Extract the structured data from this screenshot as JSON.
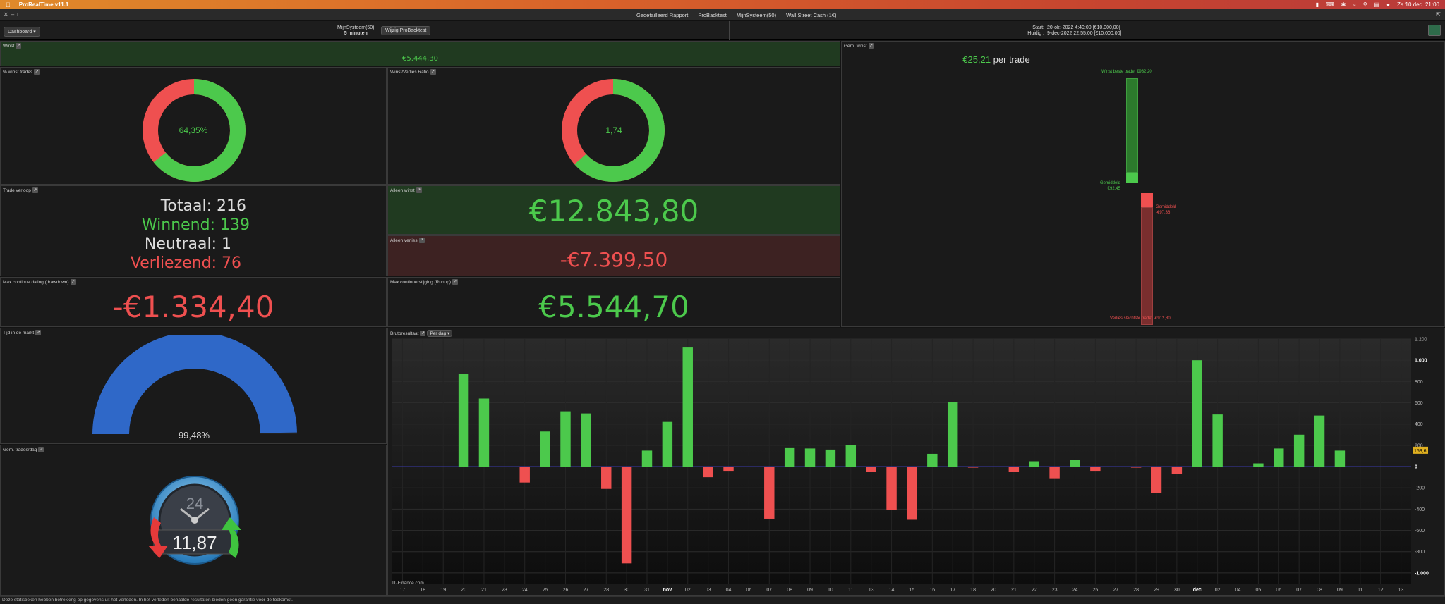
{
  "menubar": {
    "app_name": "ProRealTime v11.1",
    "clock": "Za 10 dec.  21:00"
  },
  "titlebar": {
    "tabs": [
      "Gedetailleerd Rapport",
      "ProBacktest",
      "MijnSysteem(50)",
      "Wall Street Cash (1€)"
    ]
  },
  "topbar": {
    "dashboard_label": "Dashboard",
    "system_name": "MijnSysteem(50)",
    "timeframe": "5 minuten",
    "wijzig_label": "Wijzig ProBacktest",
    "start_label": "Start:",
    "start_value": "20-okt-2022 4:40:00 [€10.000,00]",
    "huidig_label": "Huidig :",
    "huidig_value": "9-dec-2022 22:55:00 [€10.000,00]"
  },
  "winst": {
    "title": "Winst",
    "value": "€5.444,30"
  },
  "pct_winst": {
    "title": "% winst trades",
    "value": "64,35%",
    "fraction": 0.6435
  },
  "wv_ratio": {
    "title": "Winst/Verlies Ratio",
    "value": "1,74",
    "fraction": 0.635
  },
  "gem_winst": {
    "title": "Gem. winst",
    "per_trade_value": "€25,21",
    "per_trade_label": "per trade",
    "best_label": "Winst beste trade: €932,20",
    "avg_win_label": "Gemiddeld",
    "avg_win_value": "€92,45",
    "avg_loss_label": "Gemiddeld",
    "avg_loss_value": "-€97,36",
    "worst_label": "Verlies slechtste trade: -€912,80",
    "best": 932.2,
    "avg_win": 92.45,
    "avg_loss": -97.36,
    "worst": -912.8
  },
  "trade_verloop": {
    "title": "Trade verloop",
    "rows": [
      {
        "label": "Totaal:",
        "value": "216"
      },
      {
        "label": "Winnend:",
        "value": "139"
      },
      {
        "label": "Neutraal:",
        "value": "1"
      },
      {
        "label": "Verliezend:",
        "value": "76"
      }
    ]
  },
  "alleen_winst": {
    "title": "Alleen winst",
    "value": "€12.843,80"
  },
  "alleen_verlies": {
    "title": "Alleen verlies",
    "value": "-€7.399,50"
  },
  "max_drawdown": {
    "title": "Max continue daling (drawdown)",
    "value": "-€1.334,40"
  },
  "max_runup": {
    "title": "Max continue stijging (Runup)",
    "value": "€5.544,70"
  },
  "tijd_markt": {
    "title": "Tijd in de markt",
    "value": "99,48%",
    "fraction": 0.9948
  },
  "gem_trades": {
    "title": "Gem. trades/dag",
    "value": "11,87",
    "dial_label": "24"
  },
  "colors": {
    "green": "#4cc94c",
    "red": "#ef5050",
    "blue": "#2f68c8"
  },
  "chart_data": {
    "type": "bar",
    "title": "Brutoresultaat",
    "period_selector": "Per dag",
    "watermark": "IT-Finance.com",
    "current_value_tag": "153,6",
    "ylim": [
      -1100,
      1200
    ],
    "yticks": [
      "1.200",
      "1.000",
      "800",
      "600",
      "400",
      "200",
      "0",
      "-200",
      "-400",
      "-600",
      "-800",
      "-1.000"
    ],
    "ytick_values": [
      1200,
      1000,
      800,
      600,
      400,
      200,
      0,
      -200,
      -400,
      -600,
      -800,
      -1000
    ],
    "categories": [
      "17",
      "18",
      "19",
      "20",
      "21",
      "23",
      "24",
      "25",
      "26",
      "27",
      "28",
      "30",
      "31",
      "nov",
      "02",
      "03",
      "04",
      "06",
      "07",
      "08",
      "09",
      "10",
      "11",
      "13",
      "14",
      "15",
      "16",
      "17",
      "18",
      "20",
      "21",
      "22",
      "23",
      "24",
      "25",
      "27",
      "28",
      "29",
      "30",
      "dec",
      "02",
      "04",
      "05",
      "06",
      "07",
      "08",
      "09",
      "11",
      "12",
      "13"
    ],
    "values": [
      0,
      0,
      0,
      870,
      640,
      0,
      -150,
      330,
      520,
      500,
      -210,
      -910,
      150,
      420,
      1120,
      -100,
      -40,
      0,
      -490,
      180,
      170,
      160,
      200,
      -50,
      -410,
      -500,
      120,
      610,
      -10,
      0,
      -50,
      50,
      -110,
      60,
      -40,
      0,
      -10,
      -250,
      -70,
      1000,
      490,
      0,
      30,
      170,
      300,
      480,
      150,
      0,
      0,
      0
    ]
  },
  "footer": {
    "text": "Deze statistieken hebben betrekking op gegevens uit het verleden. In het verleden behaalde resultaten bieden geen garantie voor de toekomst."
  }
}
